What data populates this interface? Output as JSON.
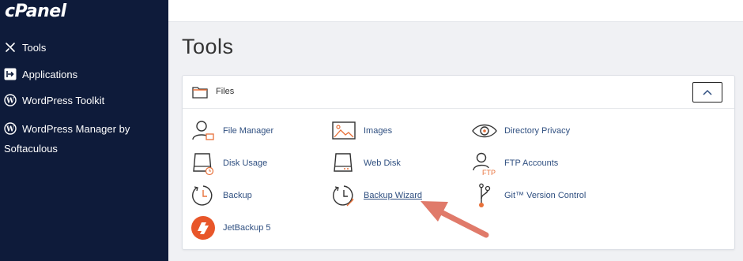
{
  "sidebar": {
    "logo": "cPanel",
    "items": [
      {
        "label": "Tools",
        "icon": "tools-icon"
      },
      {
        "label": "Applications",
        "icon": "applications-icon"
      },
      {
        "label": "WordPress Toolkit",
        "icon": "wordpress-icon"
      },
      {
        "label": "WordPress Manager by Softaculous",
        "icon": "wordpress-icon"
      }
    ]
  },
  "main": {
    "title": "Tools",
    "section": {
      "title": "Files",
      "tools": [
        {
          "label": "File Manager",
          "icon": "file-manager-icon"
        },
        {
          "label": "Images",
          "icon": "images-icon"
        },
        {
          "label": "Directory Privacy",
          "icon": "directory-privacy-icon"
        },
        {
          "label": "Disk Usage",
          "icon": "disk-usage-icon"
        },
        {
          "label": "Web Disk",
          "icon": "web-disk-icon"
        },
        {
          "label": "FTP Accounts",
          "icon": "ftp-accounts-icon"
        },
        {
          "label": "Backup",
          "icon": "backup-icon"
        },
        {
          "label": "Backup Wizard",
          "icon": "backup-wizard-icon"
        },
        {
          "label": "Git™ Version Control",
          "icon": "git-icon"
        },
        {
          "label": "JetBackup 5",
          "icon": "jetbackup-icon"
        }
      ]
    }
  },
  "colors": {
    "sidebar_bg": "#0e1b3a",
    "accent_orange": "#e8713a",
    "link_blue": "#2f4f80",
    "annotation_arrow": "#e07a6a"
  }
}
